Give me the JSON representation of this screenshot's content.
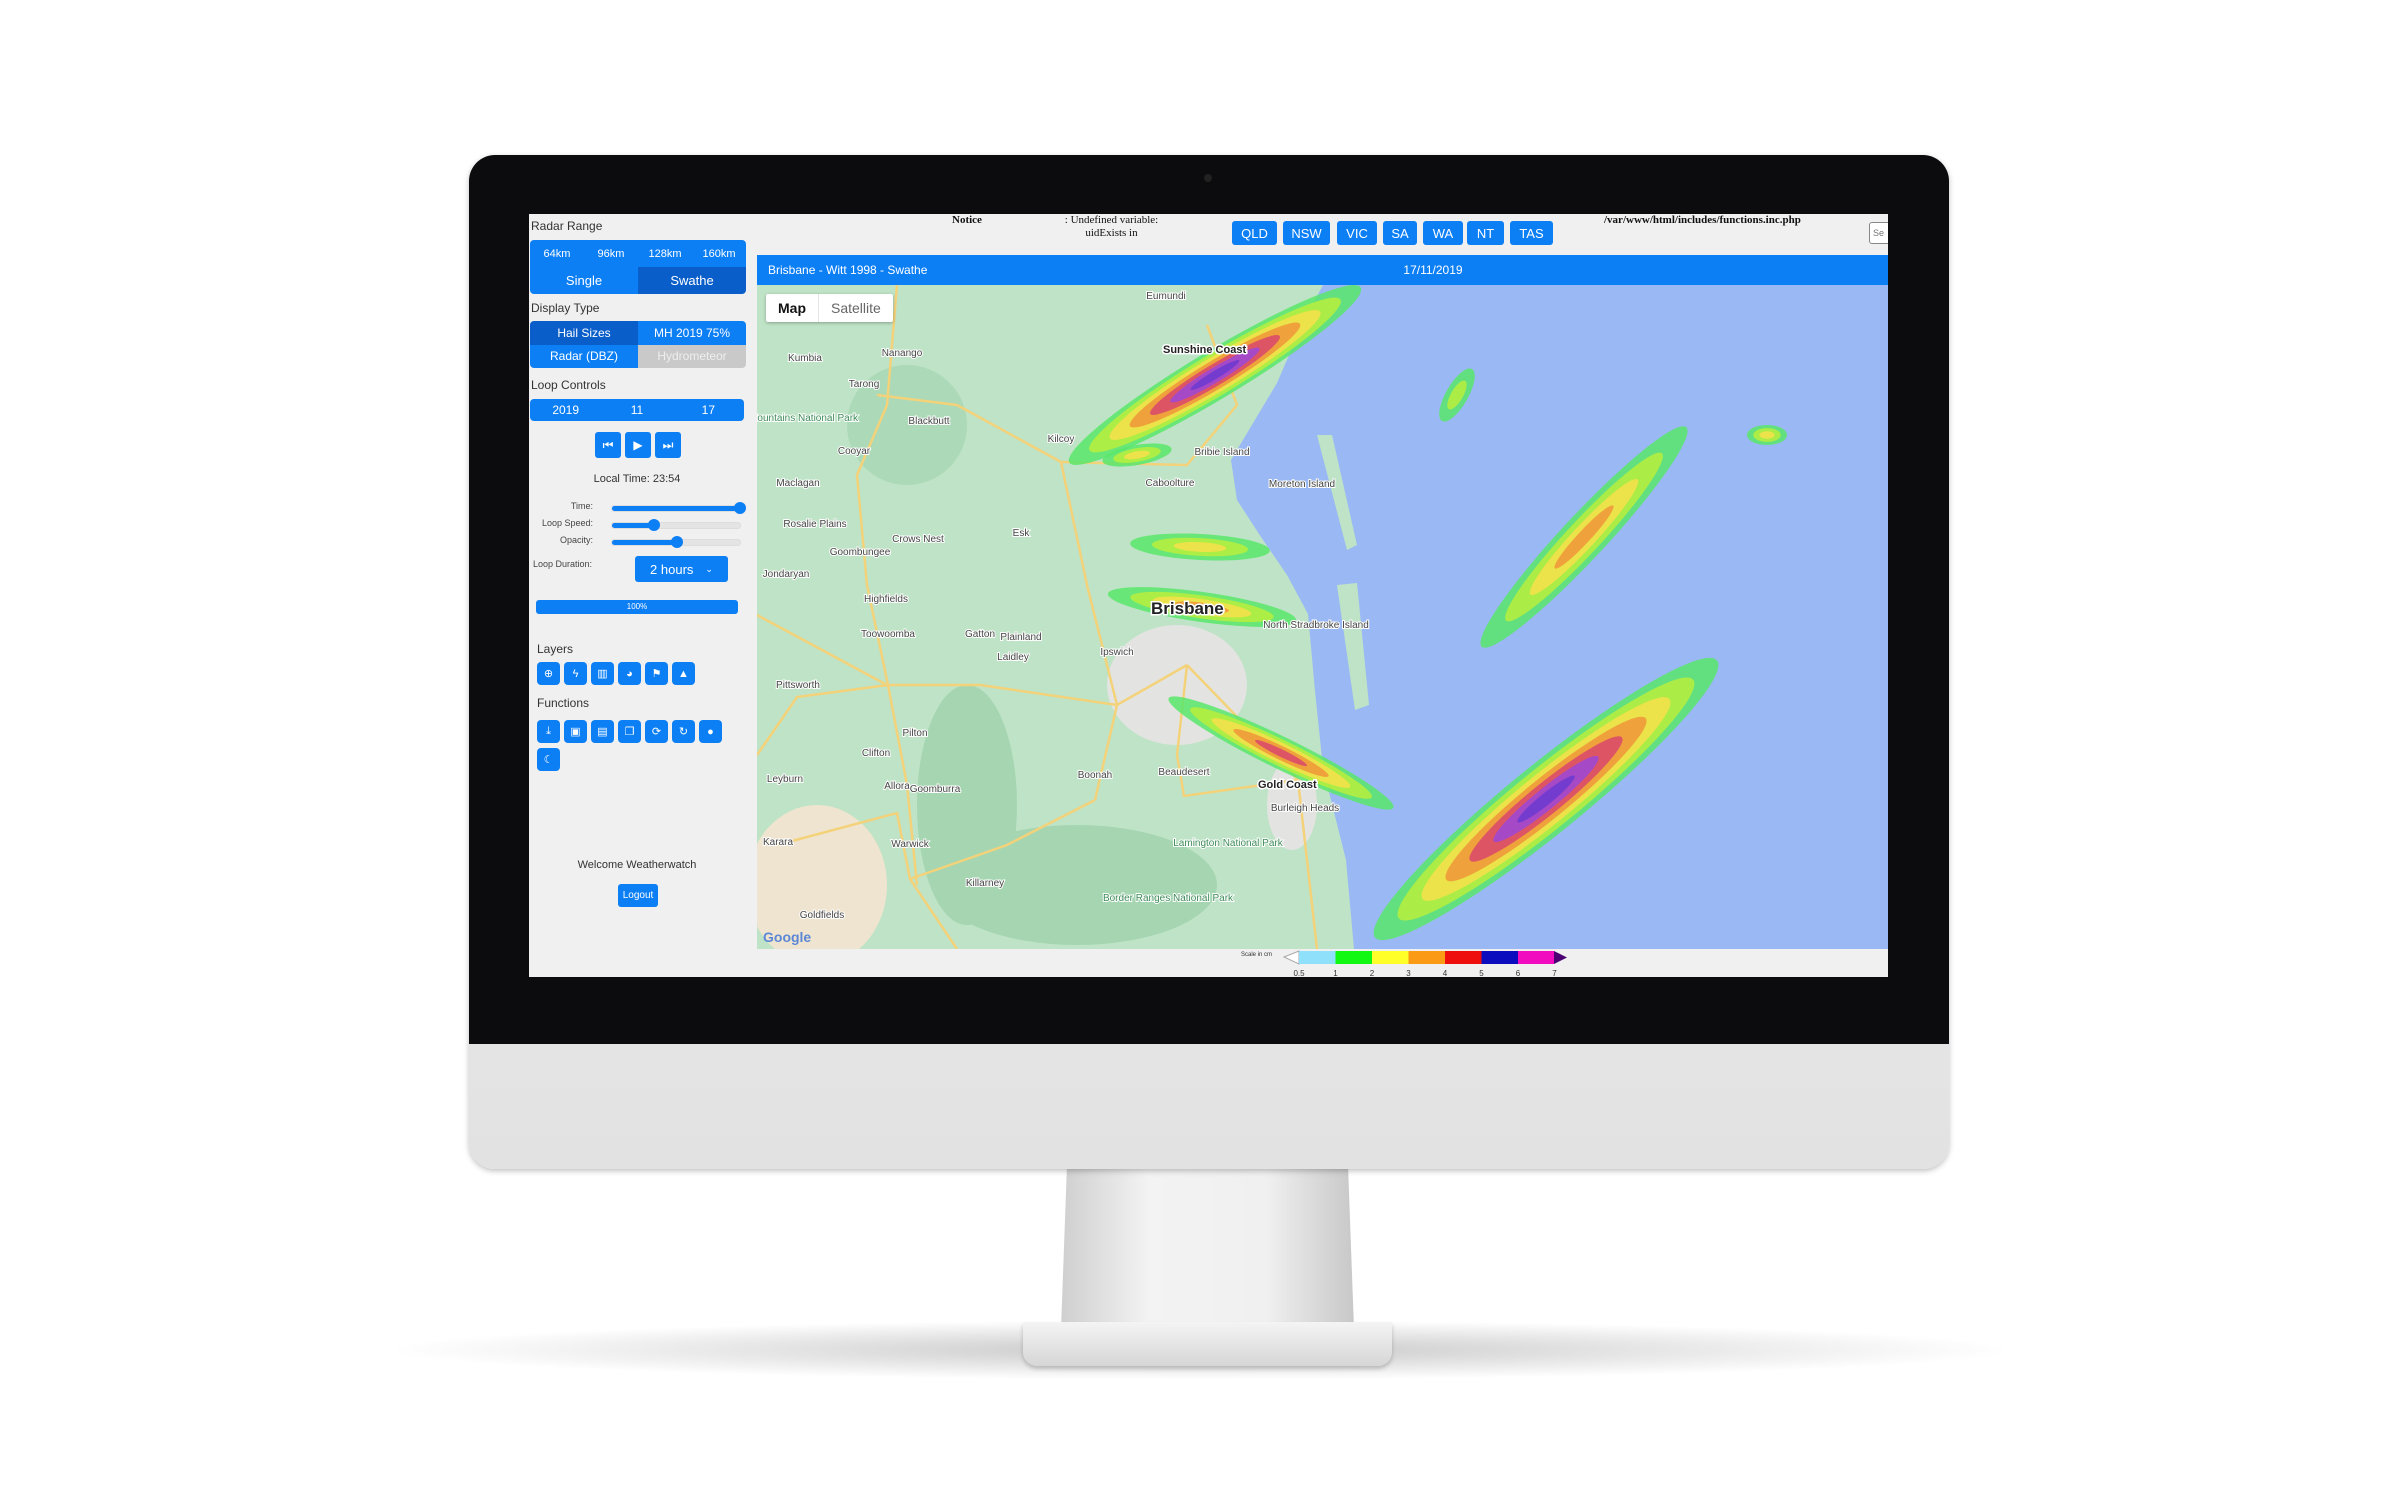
{
  "sidebar": {
    "radar_range": {
      "title": "Radar Range",
      "ranges": [
        "64km",
        "96km",
        "128km",
        "160km"
      ],
      "modes": [
        "Single",
        "Swathe"
      ],
      "selected_mode": "Swathe"
    },
    "display_type": {
      "title": "Display Type",
      "options": [
        "Hail Sizes",
        "MH 2019 75%",
        "Radar (DBZ)",
        "Hydrometeor"
      ],
      "selected": "Hail Sizes",
      "disabled": "Hydrometeor"
    },
    "loop_controls": {
      "title": "Loop Controls",
      "date": [
        "2019",
        "11",
        "17"
      ],
      "buttons": [
        "skip-back-icon",
        "play-icon",
        "skip-forward-icon"
      ],
      "local_time": "Local Time: 23:54",
      "sliders": [
        {
          "label": "Time:",
          "value_percent": 100
        },
        {
          "label": "Loop Speed:",
          "value_percent": 33
        },
        {
          "label": "Opacity:",
          "value_percent": 51
        }
      ],
      "duration_label": "Loop Duration:",
      "duration_value": "2 hours",
      "progress_text": "100%",
      "progress_percent": 100
    },
    "layers": {
      "title": "Layers",
      "icons": [
        "crosshair-icon",
        "lightning-icon",
        "map-icon",
        "globe-icon",
        "flag-icon",
        "shapes-icon"
      ]
    },
    "functions": {
      "title": "Functions",
      "icons": [
        "download-icon",
        "save-icon",
        "file-icon",
        "copy-icon",
        "sync-icon",
        "refresh-icon",
        "map-pin-icon",
        "moon-icon"
      ]
    },
    "welcome": "Welcome Weatherwatch",
    "logout": "Logout"
  },
  "topbar": {
    "notice": "Notice",
    "notice_msg_1": ": Undefined variable:",
    "notice_msg_2": "uidExists in",
    "notice_path": "/var/www/html/includes/functions.inc.php",
    "search_placeholder": "Se",
    "states": [
      "QLD",
      "NSW",
      "VIC",
      "SA",
      "WA",
      "NT",
      "TAS"
    ]
  },
  "header": {
    "title": "Brisbane - Witt 1998 - Swathe",
    "date": "17/11/2019"
  },
  "map": {
    "tabs": [
      "Map",
      "Satellite"
    ],
    "selected_tab": "Map",
    "attribution": "Google",
    "cities": [
      "Brisbane",
      "Sunshine Coast",
      "Gold Coast"
    ],
    "places": [
      "Eumundi",
      "Kumbia",
      "Nanango",
      "Tarong",
      "Blackbutt",
      "Kilcoy",
      "Bribie Island",
      "Caboolture",
      "Moreton Island",
      "Cooyar",
      "Maclagan",
      "Rosalie Plains",
      "Crows Nest",
      "Esk",
      "Goombungee",
      "Jondaryan",
      "Highfields",
      "Toowoomba",
      "Gatton",
      "Plainland",
      "Laidley",
      "Ipswich",
      "North Stradbroke Island",
      "Pittsworth",
      "Pilton",
      "Clifton",
      "Leyburn",
      "Allora",
      "Goomburra",
      "Boonah",
      "Beaudesert",
      "Burleigh Heads",
      "Warwick",
      "Karara",
      "Killarney",
      "Goldfields"
    ],
    "parks": [
      "Bunya Mountains National Park",
      "Lamington National Park",
      "Border Ranges National Park"
    ],
    "colors": {
      "land": "#bfe3c6",
      "ocean": "#9ab8f4",
      "road": "#f3d27a"
    }
  },
  "legend": {
    "title": "Scale in cm",
    "ticks": [
      "0.5",
      "1",
      "2",
      "3",
      "4",
      "5",
      "6",
      "7"
    ],
    "colors": [
      "#8fe0fb",
      "#12f812",
      "#ffff2a",
      "#fb9a14",
      "#ee0e0e",
      "#0c0cbf",
      "#f20cbf",
      "#4b0073"
    ]
  },
  "theme": {
    "accent": "#0d7ff5",
    "accent_dark": "#0a5ec9",
    "panel": "#f0f0f0"
  }
}
